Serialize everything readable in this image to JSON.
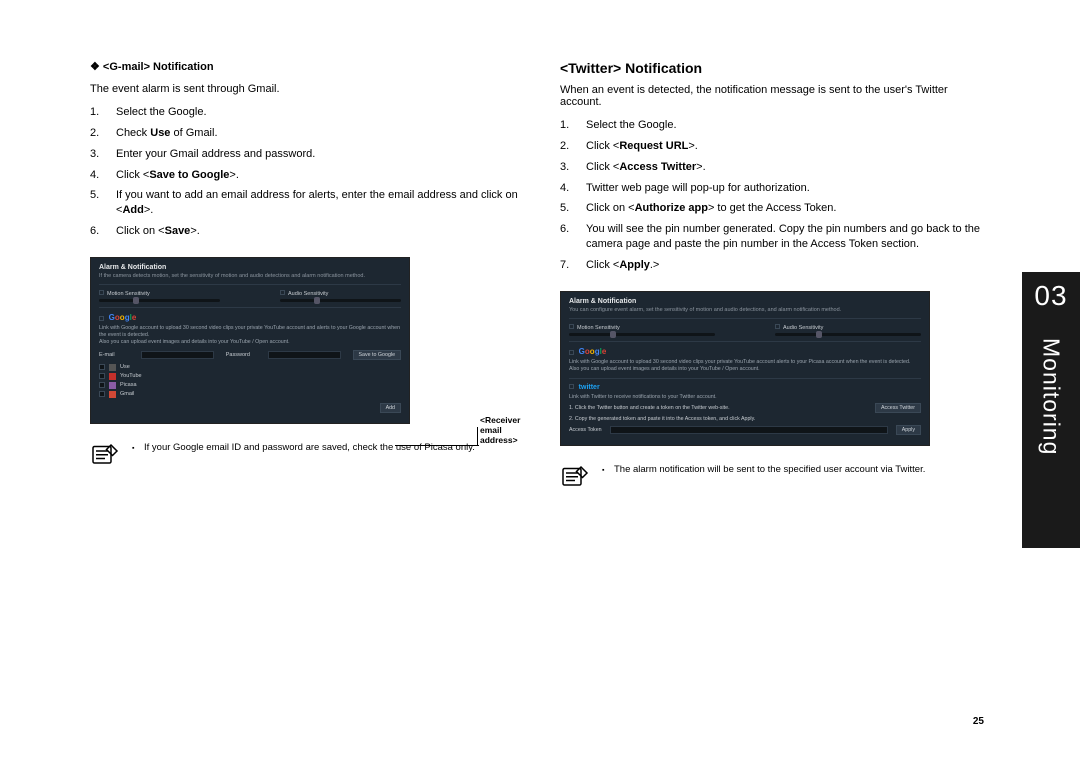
{
  "sidebar": {
    "chapter_number": "03",
    "chapter_title": "Monitoring"
  },
  "page_number": "25",
  "left": {
    "heading": "<G-mail> Notification",
    "desc": "The event alarm is sent through Gmail.",
    "steps": [
      "Select the Google.",
      "Check <b>Use</b> of Gmail.",
      "Enter your Gmail address and password.",
      "Click <<b>Save to Google</b>>.",
      "If you want to add an email address for alerts, enter the email address and click on <<b>Add</b>>.",
      "Click on <<b>Save</b>>."
    ],
    "callout": "<Receiver email address>",
    "note": "If your Google email ID and password are saved, check the use of Picasa only.",
    "shot": {
      "title": "Alarm & Notification",
      "sub": "If the camera detects motion, set the sensitivity of motion and audio detections and alarm notification method.",
      "motion_label": "Motion Sensitivity",
      "audio_label": "Audio Sensitivity",
      "google_desc": "Link with Google account to upload 30 second video clips your private YouTube account and alerts to your Google account when the event is detected.\nAlso you can upload event images and details into your YouTube / Open account.",
      "email_label": "E-mail",
      "password_label": "Password",
      "save_btn": "Save to Google",
      "add_btn": "Add",
      "services": [
        "Use",
        "YouTube",
        "Picasa",
        "Gmail"
      ]
    }
  },
  "right": {
    "heading": "<Twitter> Notification",
    "desc": "When an event is detected, the notification message is sent to the user's Twitter account.",
    "steps": [
      "Select the Google.",
      "Click <<b>Request URL</b>>.",
      "Click <<b>Access Twitter</b>>.",
      "Twitter web page will pop-up for authorization.",
      "Click on <<b>Authorize app</b>> to get the Access Token.",
      "You will see the pin number generated. Copy the pin numbers and go back to the camera page and paste the pin number in the Access Token section.",
      "Click <<b>Apply</b>.>"
    ],
    "note": "The alarm notification will be sent to the specified user account via Twitter.",
    "shot": {
      "title": "Alarm & Notification",
      "sub": "You can configure event alarm, set the sensitivity of motion and audio detections, and alarm notification method.",
      "motion_label": "Motion Sensitivity",
      "audio_label": "Audio Sensitivity",
      "google_desc": "Link with Google account to upload 30 second video clips your private YouTube account alerts to your Picasa account when the event is detected.\nAlso you can upload event images and details into your YouTube / Open account.",
      "twitter_desc": "Link with Twitter to receive notifications to your Twitter account.",
      "step1": "1. Click the Twitter button and create a token on the Twitter web-site.",
      "step2": "2. Copy the generated token and paste it into the Access token, and click Apply.",
      "access_label": "Access Token",
      "access_btn": "Access Twitter",
      "apply_btn": "Apply"
    }
  }
}
